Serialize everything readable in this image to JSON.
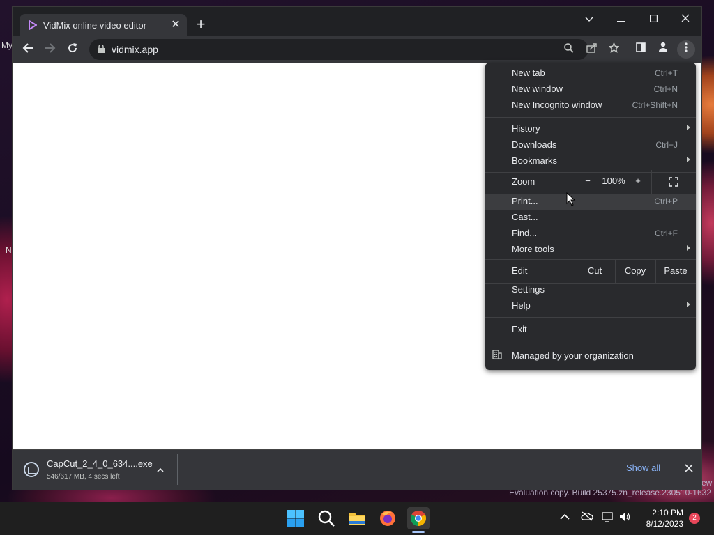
{
  "browser": {
    "tab": {
      "title": "VidMix online video editor",
      "favicon": "vidmix-play-icon",
      "close_icon": "close-icon"
    },
    "new_tab_icon": "plus-icon",
    "window_controls": [
      "chevron-down-icon",
      "minimize-icon",
      "maximize-icon",
      "close-icon"
    ],
    "address_bar": {
      "url": "vidmix.app",
      "lock_icon": "lock-icon"
    },
    "nav_icons": [
      "back-arrow-icon",
      "forward-arrow-icon",
      "reload-icon"
    ],
    "omnibox_icons": [
      "zoom-magnifier-icon",
      "share-icon",
      "bookmark-star-icon"
    ],
    "toolbar_icons": [
      "side-panel-icon",
      "profile-icon",
      "kebab-menu-icon"
    ]
  },
  "menu": {
    "group1": [
      {
        "label": "New tab",
        "shortcut": "Ctrl+T"
      },
      {
        "label": "New window",
        "shortcut": "Ctrl+N"
      },
      {
        "label": "New Incognito window",
        "shortcut": "Ctrl+Shift+N"
      }
    ],
    "group2": [
      {
        "label": "History",
        "submenu": true
      },
      {
        "label": "Downloads",
        "shortcut": "Ctrl+J"
      },
      {
        "label": "Bookmarks",
        "submenu": true
      }
    ],
    "zoom": {
      "label": "Zoom",
      "minus": "−",
      "value": "100%",
      "plus": "+",
      "fullscreen_icon": "fullscreen-icon"
    },
    "group3": [
      {
        "label": "Print...",
        "shortcut": "Ctrl+P",
        "highlighted": true
      },
      {
        "label": "Cast..."
      },
      {
        "label": "Find...",
        "shortcut": "Ctrl+F"
      },
      {
        "label": "More tools",
        "submenu": true
      }
    ],
    "edit": {
      "label": "Edit",
      "cut": "Cut",
      "copy": "Copy",
      "paste": "Paste"
    },
    "group4": [
      {
        "label": "Settings"
      },
      {
        "label": "Help",
        "submenu": true
      }
    ],
    "exit": {
      "label": "Exit"
    },
    "managed": {
      "label": "Managed by your organization",
      "icon": "building-icon"
    }
  },
  "download_bar": {
    "file_name": "CapCut_2_4_0_634....exe",
    "status": "546/617 MB, 4 secs left",
    "show_all": "Show all",
    "file_icon": "installer-file-icon",
    "chevron_icon": "chevron-up-icon",
    "close_icon": "close-icon"
  },
  "desktop": {
    "left_labels": [
      "My",
      "N"
    ],
    "watermark": "Evaluation copy. Build 25375.zn_release.230510-1632",
    "watermark_suffix": "ew"
  },
  "taskbar": {
    "apps": [
      "windows-start-icon",
      "search-icon",
      "file-explorer-icon",
      "firefox-icon",
      "chrome-icon"
    ],
    "tray_icons": [
      "chevron-up-icon",
      "cloud-offline-icon",
      "network-icon",
      "volume-icon"
    ],
    "time": "2:10 PM",
    "date": "8/12/2023",
    "notification_count": "2"
  },
  "colors": {
    "accent_link": "#8ab4f8",
    "menu_bg": "#292a2d",
    "toolbar_bg": "#35363a",
    "tabstrip_bg": "#202124"
  }
}
